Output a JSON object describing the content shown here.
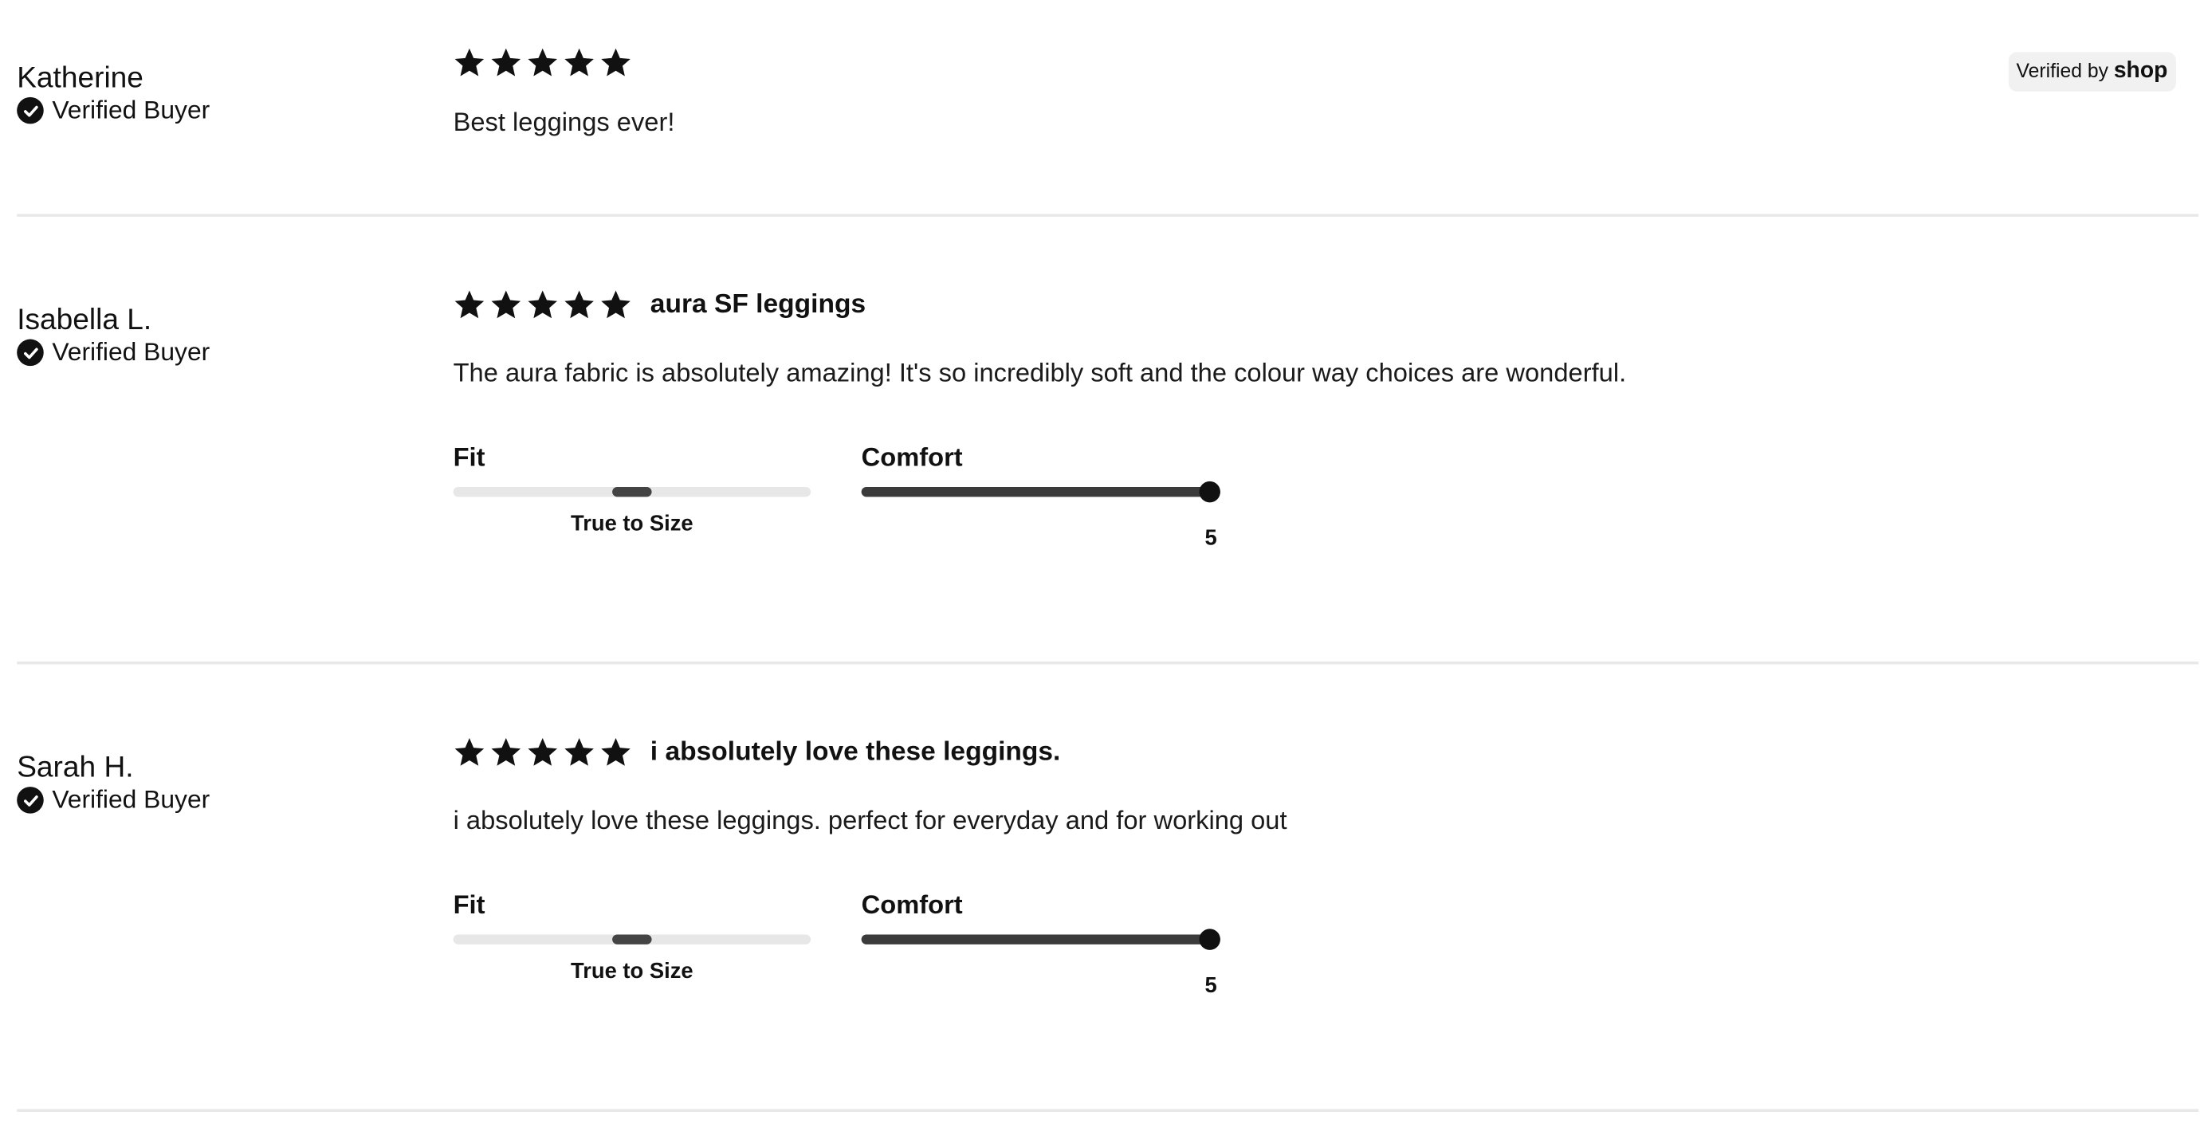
{
  "badge": {
    "prefix": "Verified by",
    "brand": "shop"
  },
  "reviews": [
    {
      "author": "Katherine",
      "verified_label": "Verified Buyer",
      "rating": 5,
      "title": "",
      "body": "Best leggings ever!"
    },
    {
      "author": "Isabella L.",
      "verified_label": "Verified Buyer",
      "rating": 5,
      "title": "aura SF leggings",
      "body": "The aura fabric is absolutely amazing! It's so incredibly soft and the colour way choices are wonderful.",
      "fit": {
        "label": "Fit",
        "value_text": "True to Size",
        "position": 0.5
      },
      "comfort": {
        "label": "Comfort",
        "value": "5",
        "max": 5
      }
    },
    {
      "author": "Sarah H.",
      "verified_label": "Verified Buyer",
      "rating": 5,
      "title": "i absolutely love these leggings.",
      "body": "i absolutely love these leggings. perfect for everyday and for working out",
      "fit": {
        "label": "Fit",
        "value_text": "True to Size",
        "position": 0.5
      },
      "comfort": {
        "label": "Comfort",
        "value": "5",
        "max": 5
      }
    }
  ]
}
